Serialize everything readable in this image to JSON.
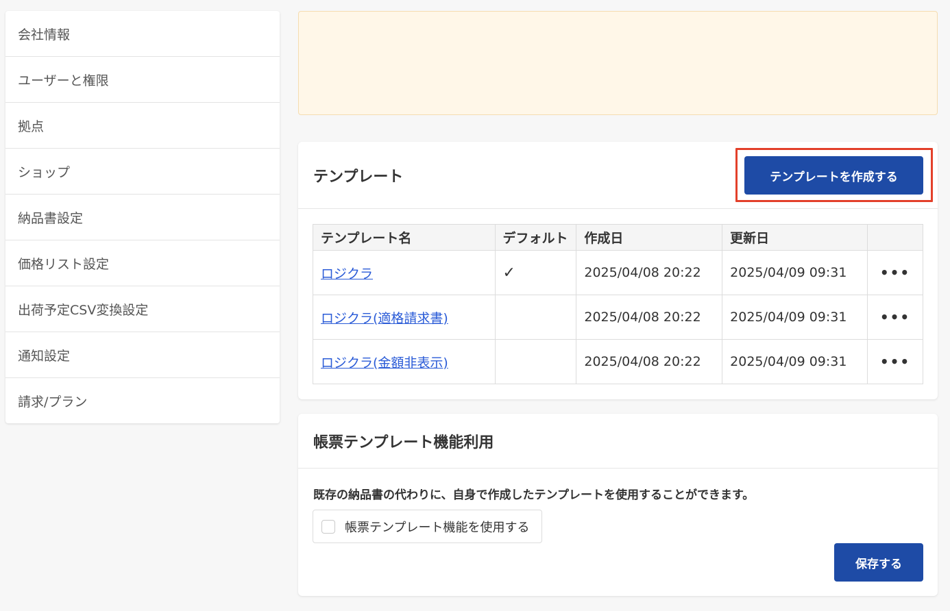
{
  "sidebar": {
    "items": [
      {
        "label": "会社情報"
      },
      {
        "label": "ユーザーと権限"
      },
      {
        "label": "拠点"
      },
      {
        "label": "ショップ"
      },
      {
        "label": "納品書設定"
      },
      {
        "label": "価格リスト設定"
      },
      {
        "label": "出荷予定CSV変換設定"
      },
      {
        "label": "通知設定"
      },
      {
        "label": "請求/プラン"
      }
    ]
  },
  "templates": {
    "title": "テンプレート",
    "create_button": "テンプレートを作成する",
    "columns": [
      "テンプレート名",
      "デフォルト",
      "作成日",
      "更新日"
    ],
    "rows": [
      {
        "name": "ロジクラ",
        "default": "✓",
        "created": "2025/04/08 20:22",
        "updated": "2025/04/09 09:31",
        "menu": "•••"
      },
      {
        "name": "ロジクラ(適格請求書)",
        "default": "",
        "created": "2025/04/08 20:22",
        "updated": "2025/04/09 09:31",
        "menu": "•••"
      },
      {
        "name": "ロジクラ(金額非表示)",
        "default": "",
        "created": "2025/04/08 20:22",
        "updated": "2025/04/09 09:31",
        "menu": "•••"
      }
    ]
  },
  "feature": {
    "title": "帳票テンプレート機能利用",
    "description": "既存の納品書の代わりに、自身で作成したテンプレートを使用することができます。",
    "checkbox_label": "帳票テンプレート機能を使用する",
    "checkbox_checked": false,
    "save_button": "保存する"
  },
  "colors": {
    "primary": "#1e4ba6",
    "link": "#2a5bd7",
    "highlight": "#e3402a",
    "notice_bg": "#fff7e8"
  }
}
